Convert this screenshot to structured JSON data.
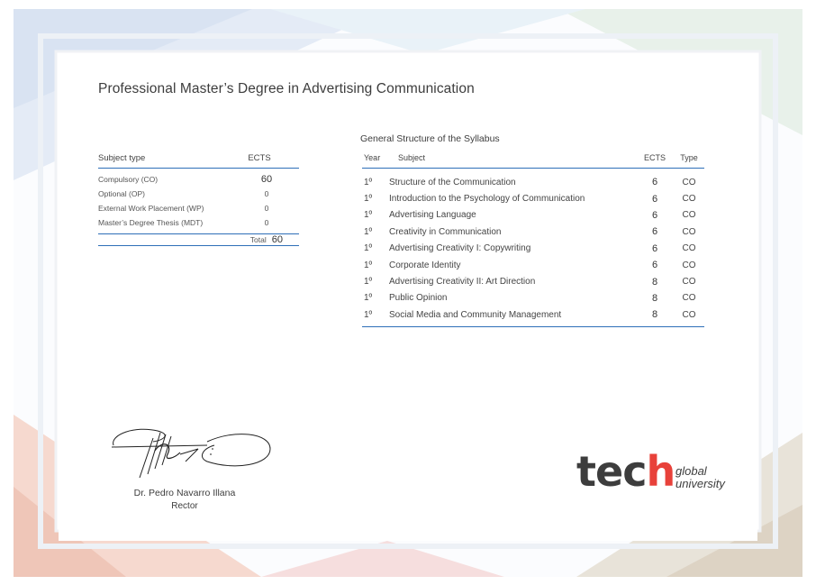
{
  "title": "Professional Master’s Degree in Advertising Communication",
  "subject_types": {
    "header": {
      "subject_type": "Subject type",
      "ects": "ECTS"
    },
    "rows": [
      {
        "label": "Compulsory (CO)",
        "ects": "60"
      },
      {
        "label": "Optional (OP)",
        "ects": "0"
      },
      {
        "label": "External Work Placement (WP)",
        "ects": "0"
      },
      {
        "label": "Master’s Degree Thesis (MDT)",
        "ects": "0"
      }
    ],
    "total_label": "Total",
    "total_value": "60"
  },
  "syllabus": {
    "caption": "General Structure of the Syllabus",
    "header": {
      "year": "Year",
      "subject": "Subject",
      "ects": "ECTS",
      "type": "Type"
    },
    "rows": [
      {
        "year": "1º",
        "subject": "Structure of the Communication",
        "ects": "6",
        "type": "CO"
      },
      {
        "year": "1º",
        "subject": "Introduction to the Psychology of Communication",
        "ects": "6",
        "type": "CO"
      },
      {
        "year": "1º",
        "subject": "Advertising Language",
        "ects": "6",
        "type": "CO"
      },
      {
        "year": "1º",
        "subject": "Creativity in Communication",
        "ects": "6",
        "type": "CO"
      },
      {
        "year": "1º",
        "subject": "Advertising Creativity I: Copywriting",
        "ects": "6",
        "type": "CO"
      },
      {
        "year": "1º",
        "subject": "Corporate Identity",
        "ects": "6",
        "type": "CO"
      },
      {
        "year": "1º",
        "subject": "Advertising Creativity II: Art Direction",
        "ects": "8",
        "type": "CO"
      },
      {
        "year": "1º",
        "subject": "Public Opinion",
        "ects": "8",
        "type": "CO"
      },
      {
        "year": "1º",
        "subject": "Social Media and Community Management",
        "ects": "8",
        "type": "CO"
      }
    ]
  },
  "signatory": {
    "name": "Dr. Pedro Navarro Illana",
    "role": "Rector"
  },
  "logo": {
    "word_main": "tec",
    "word_h": "h",
    "line1": "global",
    "line2": "university"
  },
  "colors": {
    "accent_blue": "#2e6fb8",
    "text": "#3d3d3d"
  }
}
